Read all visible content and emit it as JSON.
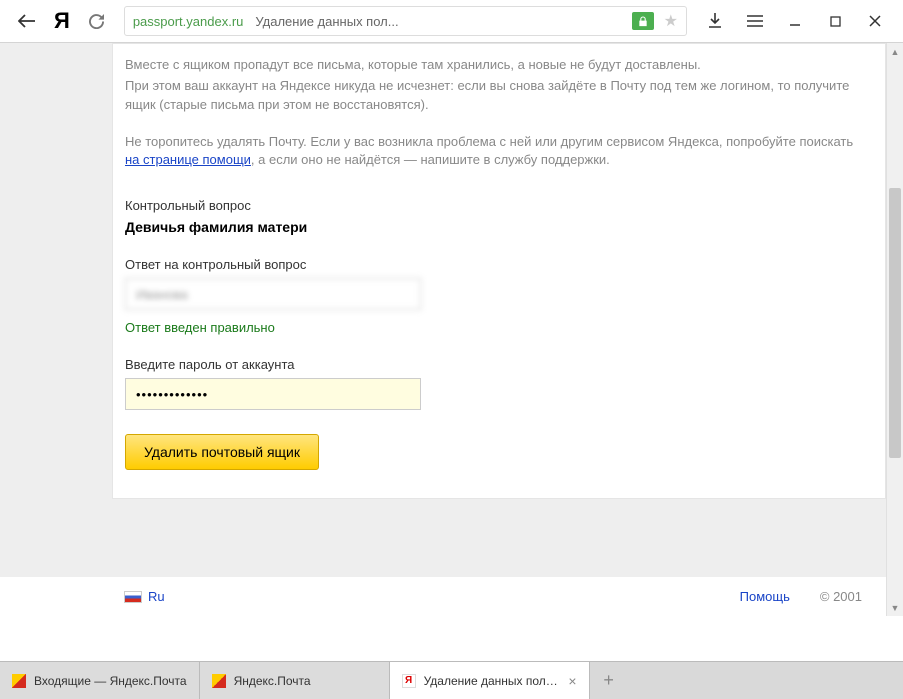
{
  "chrome": {
    "url_host": "passport.yandex.ru",
    "url_title": "Удаление данных пол..."
  },
  "content": {
    "info_line1": "Вместе с ящиком пропадут все письма, которые там хранились, а новые не будут доставлены.",
    "info_line2": "При этом ваш аккаунт на Яндексе никуда не исчезнет: если вы снова зайдёте в Почту под тем же логином, то получите ящик (старые письма при этом не восстановятся).",
    "info_line3_pre": "Не торопитесь удалять Почту. Если у вас возникла проблема с ней или другим сервисом Яндекса, попробуйте поискать ",
    "help_link": "на странице помощи",
    "info_line3_post": ", а если оно не найдётся — напишите в службу поддержки.",
    "control_q_label": "Контрольный вопрос",
    "control_q_text": "Девичья фамилия матери",
    "answer_label": "Ответ на контрольный вопрос",
    "answer_value": "Иванова",
    "answer_correct": "Ответ введен правильно",
    "password_label": "Введите пароль от аккаунта",
    "password_value": "•••••••••••••",
    "delete_btn": "Удалить почтовый ящик"
  },
  "footer": {
    "lang": "Ru",
    "help": "Помощь",
    "copyright": "© 2001"
  },
  "tabs": [
    {
      "label": "Входящие — Яндекс.Почта"
    },
    {
      "label": "Яндекс.Почта"
    },
    {
      "label": "Удаление данных пользс"
    }
  ],
  "tab_add": "+"
}
